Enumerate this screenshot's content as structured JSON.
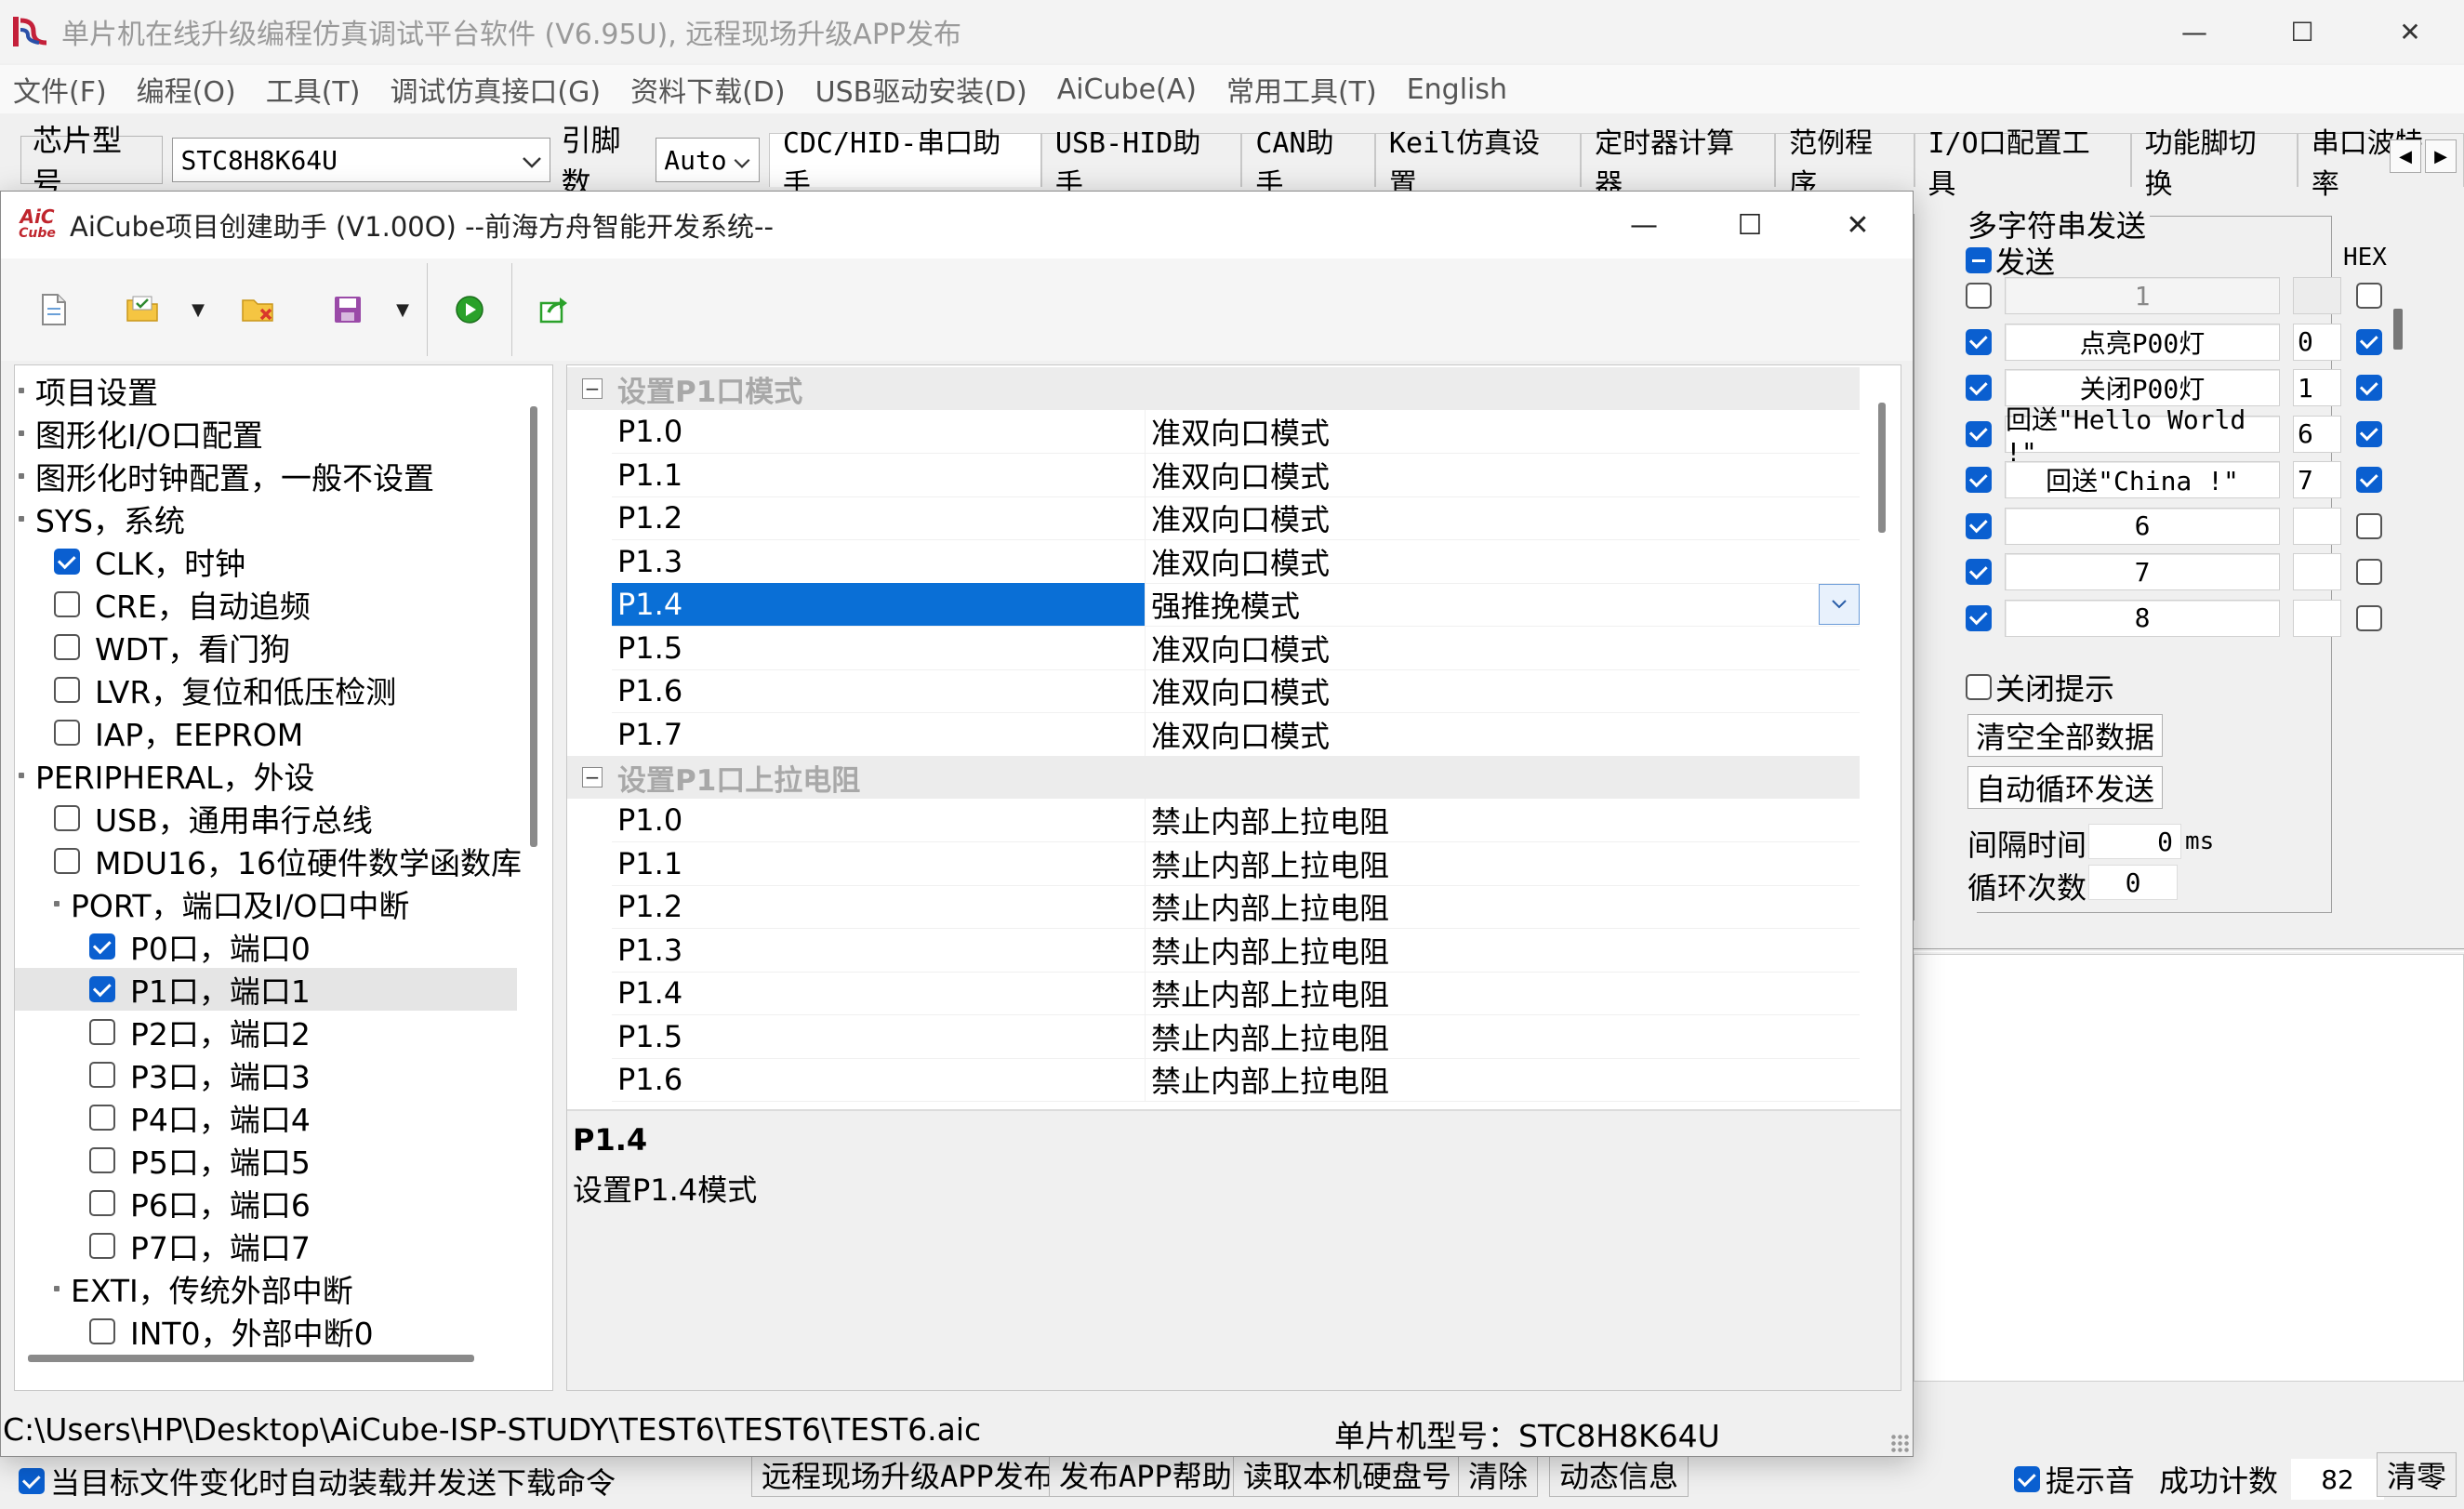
{
  "main_window": {
    "title": "单片机在线升级编程仿真调试平台软件 (V6.95U), 远程现场升级APP发布",
    "controls": {
      "minimize": "—",
      "maximize": "☐",
      "close": "✕"
    }
  },
  "menu": [
    "文件(F)",
    "编程(O)",
    "工具(T)",
    "调试仿真接口(G)",
    "资料下载(D)",
    "USB驱动安装(D)",
    "AiCube(A)",
    "常用工具(T)",
    "English"
  ],
  "topbar": {
    "chip_label": "芯片型号",
    "chip_value": "STC8H8K64U",
    "pins_label": "引脚数",
    "pins_value": "Auto",
    "tabs": [
      "CDC/HID-串口助手",
      "USB-HID助手",
      "CAN助手",
      "Keil仿真设置",
      "定时器计算器",
      "范例程序",
      "I/O口配置工具",
      "功能脚切换",
      "串口波特率"
    ]
  },
  "right_panel": {
    "group_title": "多字符串发送",
    "send_label": "发送",
    "hex_label": "HEX",
    "rows": [
      {
        "text": "1",
        "num": "",
        "checked": false,
        "hex": false,
        "dim": true
      },
      {
        "text": "点亮P00灯",
        "num": "0",
        "checked": true,
        "hex": true,
        "dim": false
      },
      {
        "text": "关闭P00灯",
        "num": "1",
        "checked": true,
        "hex": true,
        "dim": false
      },
      {
        "text": "回送\"Hello World !\"",
        "num": "6",
        "checked": true,
        "hex": true,
        "dim": false
      },
      {
        "text": "回送\"China !\"",
        "num": "7",
        "checked": true,
        "hex": true,
        "dim": false
      },
      {
        "text": "6",
        "num": "",
        "checked": true,
        "hex": false,
        "dim": false
      },
      {
        "text": "7",
        "num": "",
        "checked": true,
        "hex": false,
        "dim": false
      },
      {
        "text": "8",
        "num": "",
        "checked": true,
        "hex": false,
        "dim": false
      }
    ],
    "close_tip": "关闭提示",
    "clear_all": "清空全部数据",
    "auto_loop": "自动循环发送",
    "interval_label": "间隔时间",
    "interval_value": "0",
    "interval_unit": "ms",
    "loop_label": "循环次数",
    "loop_value": "0"
  },
  "bottom_bar": {
    "auto_load_label": "当目标文件变化时自动装载并发送下载命令",
    "buttons": [
      "远程现场升级APP发布",
      "发布APP帮助",
      "读取本机硬盘号",
      "清除",
      "动态信息"
    ],
    "beep_label": "提示音",
    "success_label": "成功计数",
    "success_value": "82",
    "clear_zero": "清零"
  },
  "dialog": {
    "logo_top": "AiC",
    "logo_bottom": "Cube",
    "title": "AiCube项目创建助手 (V1.00O) --前海方舟智能开发系统--",
    "controls": {
      "minimize": "—",
      "maximize": "☐",
      "close": "✕"
    },
    "toolbar_icons": [
      "new-file-icon",
      "open-folder-icon",
      "close-folder-icon",
      "save-icon",
      "run-icon",
      "export-icon"
    ],
    "tree": [
      {
        "label": "项目设置",
        "level": 0,
        "type": "leaf"
      },
      {
        "label": "图形化I/O口配置",
        "level": 0,
        "type": "leaf"
      },
      {
        "label": "图形化时钟配置，一般不设置",
        "level": 0,
        "type": "leaf"
      },
      {
        "label": "SYS，系统",
        "level": 0,
        "type": "group"
      },
      {
        "label": "CLK，时钟",
        "level": 1,
        "type": "check",
        "checked": true
      },
      {
        "label": "CRE，自动追频",
        "level": 1,
        "type": "check",
        "checked": false
      },
      {
        "label": "WDT，看门狗",
        "level": 1,
        "type": "check",
        "checked": false
      },
      {
        "label": "LVR，复位和低压检测",
        "level": 1,
        "type": "check",
        "checked": false
      },
      {
        "label": "IAP，EEPROM",
        "level": 1,
        "type": "check",
        "checked": false
      },
      {
        "label": "PERIPHERAL，外设",
        "level": 0,
        "type": "group"
      },
      {
        "label": "USB，通用串行总线",
        "level": 1,
        "type": "check",
        "checked": false
      },
      {
        "label": "MDU16，16位硬件数学函数库",
        "level": 1,
        "type": "check",
        "checked": false
      },
      {
        "label": "PORT，端口及I/O口中断",
        "level": 1,
        "type": "group"
      },
      {
        "label": "P0口，端口0",
        "level": 2,
        "type": "check",
        "checked": true
      },
      {
        "label": "P1口，端口1",
        "level": 2,
        "type": "check",
        "checked": true,
        "selected": true
      },
      {
        "label": "P2口，端口2",
        "level": 2,
        "type": "check",
        "checked": false
      },
      {
        "label": "P3口，端口3",
        "level": 2,
        "type": "check",
        "checked": false
      },
      {
        "label": "P4口，端口4",
        "level": 2,
        "type": "check",
        "checked": false
      },
      {
        "label": "P5口，端口5",
        "level": 2,
        "type": "check",
        "checked": false
      },
      {
        "label": "P6口，端口6",
        "level": 2,
        "type": "check",
        "checked": false
      },
      {
        "label": "P7口，端口7",
        "level": 2,
        "type": "check",
        "checked": false
      },
      {
        "label": "EXTI，传统外部中断",
        "level": 1,
        "type": "group"
      },
      {
        "label": "INT0，外部中断0",
        "level": 2,
        "type": "check",
        "checked": false
      }
    ],
    "property_grid": {
      "categories": [
        {
          "title": "设置P1口模式",
          "rows": [
            {
              "name": "P1.0",
              "value": "准双向口模式"
            },
            {
              "name": "P1.1",
              "value": "准双向口模式"
            },
            {
              "name": "P1.2",
              "value": "准双向口模式"
            },
            {
              "name": "P1.3",
              "value": "准双向口模式"
            },
            {
              "name": "P1.4",
              "value": "强推挽模式",
              "selected": true
            },
            {
              "name": "P1.5",
              "value": "准双向口模式"
            },
            {
              "name": "P1.6",
              "value": "准双向口模式"
            },
            {
              "name": "P1.7",
              "value": "准双向口模式"
            }
          ]
        },
        {
          "title": "设置P1口上拉电阻",
          "rows": [
            {
              "name": "P1.0",
              "value": "禁止内部上拉电阻"
            },
            {
              "name": "P1.1",
              "value": "禁止内部上拉电阻"
            },
            {
              "name": "P1.2",
              "value": "禁止内部上拉电阻"
            },
            {
              "name": "P1.3",
              "value": "禁止内部上拉电阻"
            },
            {
              "name": "P1.4",
              "value": "禁止内部上拉电阻"
            },
            {
              "name": "P1.5",
              "value": "禁止内部上拉电阻"
            },
            {
              "name": "P1.6",
              "value": "禁止内部上拉电阻"
            }
          ]
        }
      ],
      "collapse_glyph": "−"
    },
    "description": {
      "name": "P1.4",
      "text": "设置P1.4模式"
    },
    "status": {
      "path": "C:\\Users\\HP\\Desktop\\AiCube-ISP-STUDY\\TEST6\\TEST6\\TEST6.aic",
      "chip": "单片机型号：STC8H8K64U"
    }
  }
}
